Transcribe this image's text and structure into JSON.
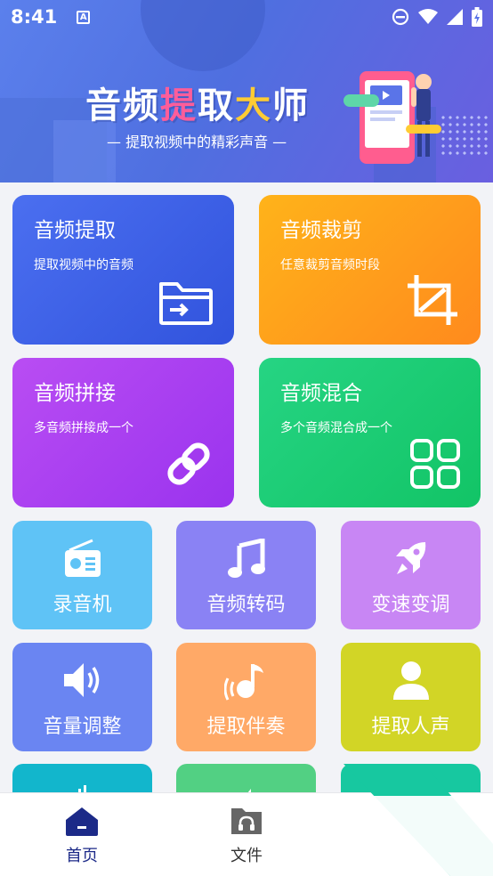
{
  "status_bar": {
    "time": "8:41",
    "notif_letter": "A"
  },
  "banner": {
    "title_chars": [
      "音",
      "频",
      "提",
      "取",
      "大",
      "师"
    ],
    "subtitle": "— 提取视频中的精彩声音 —"
  },
  "big_cards": [
    {
      "title": "音频提取",
      "desc": "提取视频中的音频",
      "icon": "folder-import-icon"
    },
    {
      "title": "音频裁剪",
      "desc": "任意裁剪音频时段",
      "icon": "crop-icon"
    },
    {
      "title": "音频拼接",
      "desc": "多音频拼接成一个",
      "icon": "link-icon"
    },
    {
      "title": "音频混合",
      "desc": "多个音频混合成一个",
      "icon": "grid-icon"
    }
  ],
  "tiles": [
    {
      "label": "录音机",
      "icon": "radio-icon"
    },
    {
      "label": "音频转码",
      "icon": "music-note-icon"
    },
    {
      "label": "变速变调",
      "icon": "rocket-icon"
    },
    {
      "label": "音量调整",
      "icon": "speaker-icon"
    },
    {
      "label": "提取伴奏",
      "icon": "accompaniment-icon"
    },
    {
      "label": "提取人声",
      "icon": "person-icon"
    }
  ],
  "bottom_nav": {
    "home": "首页",
    "files": "文件"
  },
  "colors": {
    "accent": "#1c2a88",
    "banner": "#5b80ec",
    "extract": "#3d5fe6",
    "cut": "#ff9d1b",
    "join": "#a83ff0",
    "mix": "#1bcb74"
  }
}
